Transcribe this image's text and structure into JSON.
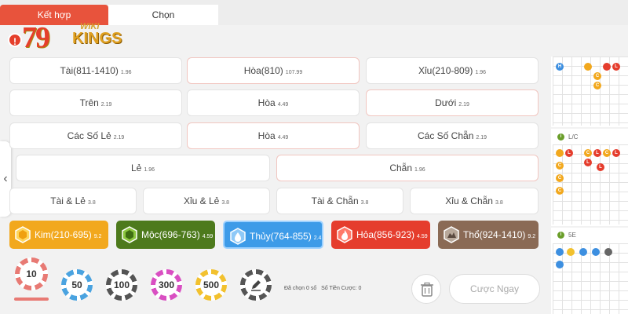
{
  "tabs": [
    {
      "label": "Kết hợp"
    },
    {
      "label": "Chọn"
    }
  ],
  "logo": {
    "badge": "!",
    "number": "79",
    "wiki": "WIKI",
    "kings": "KINGS"
  },
  "bets": [
    {
      "label": "Tài(811-1410)",
      "odds": "1.96"
    },
    {
      "label": "Hòa(810)",
      "odds": "107.99"
    },
    {
      "label": "Xỉu(210-809)",
      "odds": "1.96"
    },
    {
      "label": "Trên",
      "odds": "2.19"
    },
    {
      "label": "Hòa",
      "odds": "4.49"
    },
    {
      "label": "Dưới",
      "odds": "2.19"
    },
    {
      "label": "Các Số Lẻ",
      "odds": "2.19"
    },
    {
      "label": "Hòa",
      "odds": "4.49"
    },
    {
      "label": "Các Số Chẵn",
      "odds": "2.19"
    },
    {
      "label": "Lẻ",
      "odds": "1.96"
    },
    {
      "label": "Chẵn",
      "odds": "1.96"
    },
    {
      "label": "Tài & Lẻ",
      "odds": "3.8"
    },
    {
      "label": "Xỉu & Lẻ",
      "odds": "3.8"
    },
    {
      "label": "Tài & Chẵn",
      "odds": "3.8"
    },
    {
      "label": "Xỉu & Chẵn",
      "odds": "3.8"
    }
  ],
  "elements": [
    {
      "label": "Kim(210-695)",
      "odds": "9.2",
      "color": "#f2a81d"
    },
    {
      "label": "Mộc(696-763)",
      "odds": "4.59",
      "color": "#4d7a1c"
    },
    {
      "label": "Thủy(764-855)",
      "odds": "2.4",
      "color": "#3d9be8"
    },
    {
      "label": "Hỏa(856-923)",
      "odds": "4.59",
      "color": "#e53d2d"
    },
    {
      "label": "Thổ(924-1410)",
      "odds": "9.2",
      "color": "#8a6a55"
    }
  ],
  "chips": [
    {
      "label": "10",
      "color": "#e87a74"
    },
    {
      "label": "50",
      "color": "#4aa3e0"
    },
    {
      "label": "100",
      "color": "#555555"
    },
    {
      "label": "300",
      "color": "#d94fc2"
    },
    {
      "label": "500",
      "color": "#f2c12e"
    }
  ],
  "footer": {
    "selected": "Đã chọn 0 số",
    "amount": "Số Tiền Cược: 0",
    "confirm": "Cược Ngay"
  },
  "side_panel": {
    "label2": "L/C",
    "label3": "5E",
    "info_glyph": "i",
    "row1": [
      "H",
      "",
      "C",
      "",
      "L",
      "C"
    ],
    "row2": [
      "",
      "L",
      "C",
      "L",
      "C",
      "L",
      "L",
      "C",
      "L",
      "C",
      "C"
    ],
    "row3": [
      "",
      "",
      "",
      "",
      "",
      ""
    ]
  }
}
